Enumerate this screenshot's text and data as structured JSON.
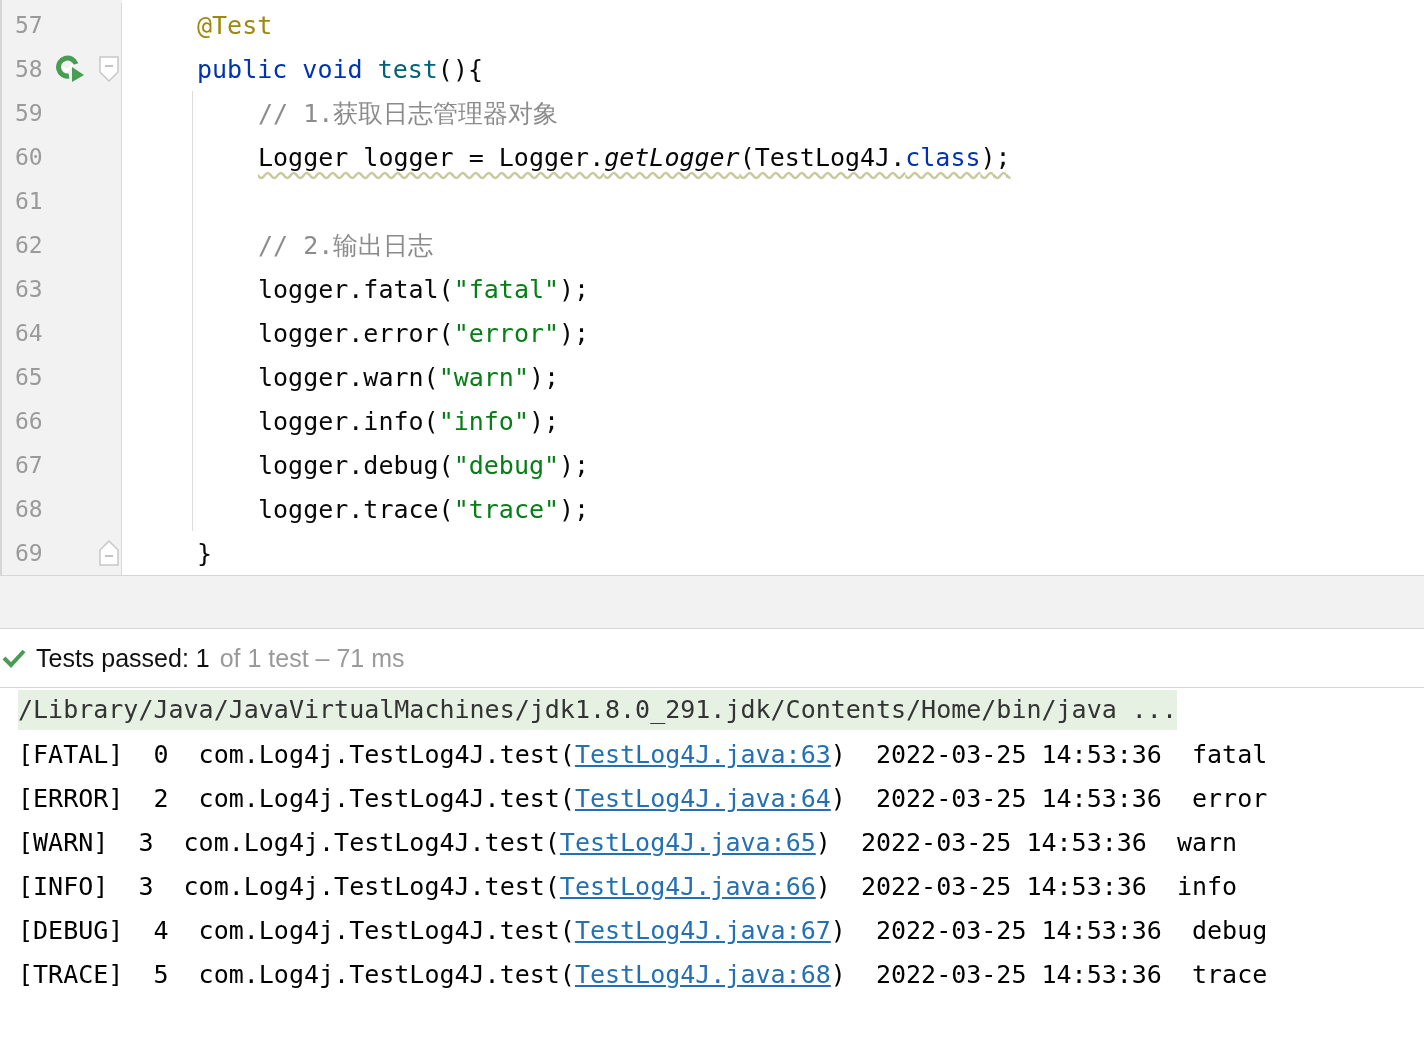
{
  "editor": {
    "lines": [
      {
        "number": "57",
        "tokens": [
          {
            "kind": "annotation",
            "text": "@Test"
          }
        ]
      },
      {
        "number": "58",
        "run_icon": true,
        "fold_open": true,
        "tokens": [
          {
            "kind": "keyword",
            "text": "public void"
          },
          {
            "kind": "method",
            "space_before": true,
            "text": "test"
          },
          {
            "kind": "plain",
            "text": "(){"
          }
        ],
        "children": [
          {
            "number": "59",
            "tokens": [
              {
                "kind": "comment",
                "text": "// 1.获取日志管理器对象"
              }
            ]
          },
          {
            "number": "60",
            "warning": true,
            "tokens": [
              {
                "kind": "plain",
                "text": "Logger logger = Logger."
              },
              {
                "kind": "static",
                "text": "getLogger"
              },
              {
                "kind": "plain",
                "text": "(TestLog4J."
              },
              {
                "kind": "keyword",
                "text": "class"
              },
              {
                "kind": "plain",
                "text": ");"
              }
            ]
          },
          {
            "number": "61"
          },
          {
            "number": "62",
            "tokens": [
              {
                "kind": "comment",
                "text": "// 2.输出日志"
              }
            ]
          },
          {
            "number": "63",
            "tokens": [
              {
                "kind": "plain",
                "text": "logger.fatal("
              },
              {
                "kind": "string",
                "text": "\"fatal\""
              },
              {
                "kind": "plain",
                "text": ");"
              }
            ]
          },
          {
            "number": "64",
            "tokens": [
              {
                "kind": "plain",
                "text": "logger.error("
              },
              {
                "kind": "string",
                "text": "\"error\""
              },
              {
                "kind": "plain",
                "text": ");"
              }
            ]
          },
          {
            "number": "65",
            "tokens": [
              {
                "kind": "plain",
                "text": "logger.warn("
              },
              {
                "kind": "string",
                "text": "\"warn\""
              },
              {
                "kind": "plain",
                "text": ");"
              }
            ]
          },
          {
            "number": "66",
            "tokens": [
              {
                "kind": "plain",
                "text": "logger.info("
              },
              {
                "kind": "string",
                "text": "\"info\""
              },
              {
                "kind": "plain",
                "text": ");"
              }
            ]
          },
          {
            "number": "67",
            "tokens": [
              {
                "kind": "plain",
                "text": "logger.debug("
              },
              {
                "kind": "string",
                "text": "\"debug\""
              },
              {
                "kind": "plain",
                "text": ");"
              }
            ]
          },
          {
            "number": "68",
            "tokens": [
              {
                "kind": "plain",
                "text": "logger.trace("
              },
              {
                "kind": "string",
                "text": "\"trace\""
              },
              {
                "kind": "plain",
                "text": ");"
              }
            ]
          }
        ]
      },
      {
        "number": "69",
        "fold_close": true,
        "tokens": [
          {
            "kind": "plain",
            "text": "}"
          }
        ]
      }
    ]
  },
  "test_status": {
    "passed": true,
    "label": "Tests passed: 1",
    "detail": "of 1 test – 71 ms"
  },
  "console": {
    "command": "/Library/Java/JavaVirtualMachines/jdk1.8.0_291.jdk/Contents/Home/bin/java ...",
    "lines": [
      {
        "prefix": "[FATAL]  0  com.Log4j.TestLog4J.test(",
        "link": "TestLog4J.java:63",
        "suffix": ")  2022-03-25 14:53:36  fatal"
      },
      {
        "prefix": "[ERROR]  2  com.Log4j.TestLog4J.test(",
        "link": "TestLog4J.java:64",
        "suffix": ")  2022-03-25 14:53:36  error"
      },
      {
        "prefix": "[WARN]  3  com.Log4j.TestLog4J.test(",
        "link": "TestLog4J.java:65",
        "suffix": ")  2022-03-25 14:53:36  warn"
      },
      {
        "prefix": "[INFO]  3  com.Log4j.TestLog4J.test(",
        "link": "TestLog4J.java:66",
        "suffix": ")  2022-03-25 14:53:36  info"
      },
      {
        "prefix": "[DEBUG]  4  com.Log4j.TestLog4J.test(",
        "link": "TestLog4J.java:67",
        "suffix": ")  2022-03-25 14:53:36  debug"
      },
      {
        "prefix": "[TRACE]  5  com.Log4j.TestLog4J.test(",
        "link": "TestLog4J.java:68",
        "suffix": ")  2022-03-25 14:53:36  trace"
      }
    ]
  }
}
